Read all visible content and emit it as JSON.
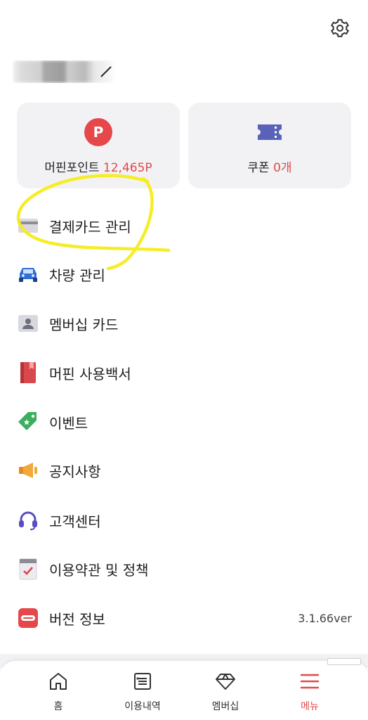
{
  "header": {
    "settings_icon": "gear-icon"
  },
  "summary": {
    "points": {
      "icon": "point-p-icon",
      "icon_letter": "P",
      "label": "머핀포인트",
      "value": "12,465P"
    },
    "coupons": {
      "icon": "ticket-icon",
      "label": "쿠폰",
      "value": "0개"
    }
  },
  "menu": {
    "items": [
      {
        "label": "결제카드 관리",
        "icon": "credit-card-icon"
      },
      {
        "label": "차량 관리",
        "icon": "car-icon"
      },
      {
        "label": "멤버십 카드",
        "icon": "member-card-icon"
      },
      {
        "label": "머핀 사용백서",
        "icon": "book-icon"
      },
      {
        "label": "이벤트",
        "icon": "tag-icon"
      },
      {
        "label": "공지사항",
        "icon": "megaphone-icon"
      },
      {
        "label": "고객센터",
        "icon": "headset-icon"
      },
      {
        "label": "이용약관 및 정책",
        "icon": "checklist-icon"
      },
      {
        "label": "버전 정보",
        "icon": "muffin-app-icon",
        "value": "3.1.66ver"
      }
    ]
  },
  "tabbar": {
    "tabs": [
      {
        "label": "홈",
        "icon": "home-icon"
      },
      {
        "label": "이용내역",
        "icon": "list-icon"
      },
      {
        "label": "멤버십",
        "icon": "diamond-icon"
      },
      {
        "label": "메뉴",
        "icon": "hamburger-menu-icon",
        "active": true
      }
    ]
  },
  "colors": {
    "accent": "#e04a4a",
    "card_bg": "#f2f2f4",
    "highlight": "#f5ec1c"
  }
}
